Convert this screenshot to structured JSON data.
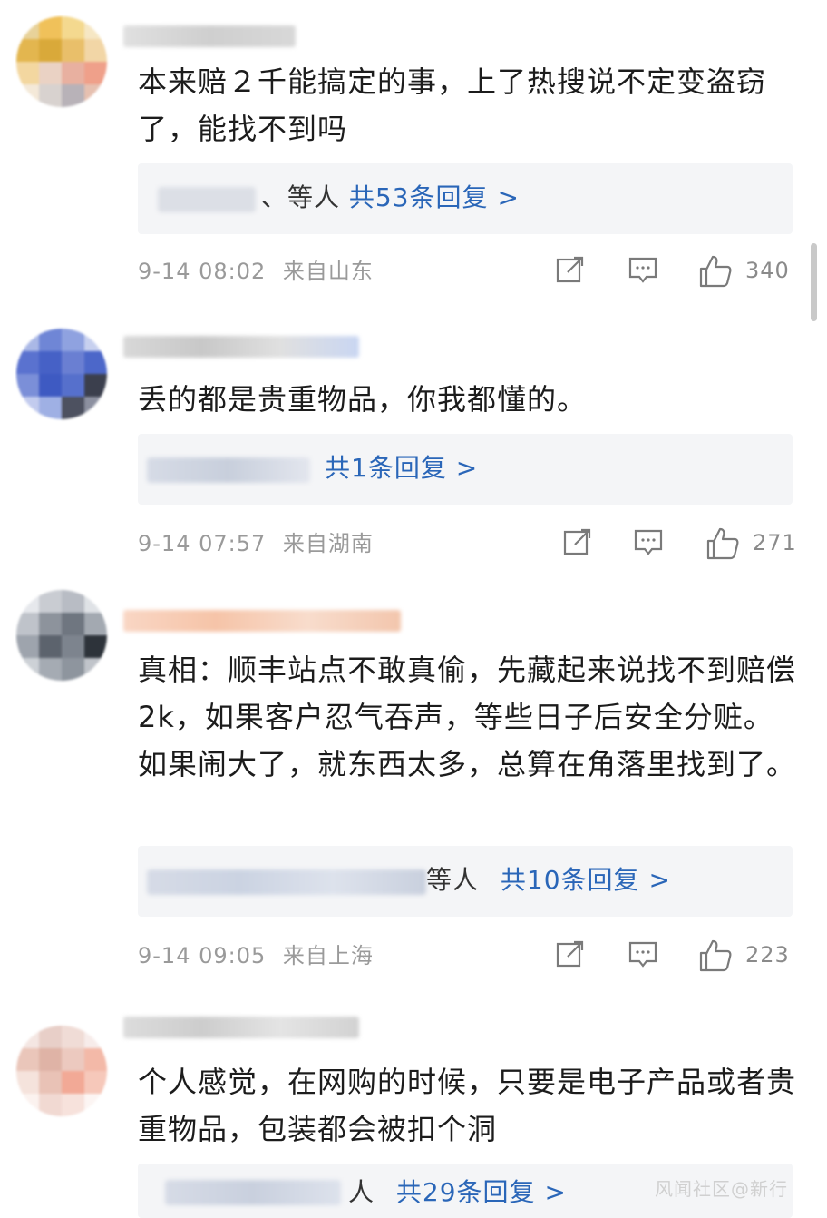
{
  "comments": [
    {
      "text": "本来赔２千能搞定的事，上了热搜说不定变盗窃了，能找不到吗",
      "reply_who": "、等人",
      "reply_more": "共53条回复 >",
      "time": "9-14 08:02",
      "location": "来自山东",
      "likes": "340"
    },
    {
      "text": "丢的都是贵重物品，你我都懂的。",
      "reply_who": "",
      "reply_more": "共1条回复 >",
      "time": "9-14 07:57",
      "location": "来自湖南",
      "likes": "271"
    },
    {
      "text": "真相：顺丰站点不敢真偷，先藏起来说找不到赔偿2k，如果客户忍气吞声，等些日子后安全分赃。如果闹大了，就东西太多，总算在角落里找到了。",
      "reply_who": "等人",
      "reply_more": "共10条回复 >",
      "time": "9-14 09:05",
      "location": "来自上海",
      "likes": "223"
    },
    {
      "text": "个人感觉，在网购的时候，只要是电子产品或者贵重物品，包装都会被扣个洞",
      "reply_who": "人",
      "reply_more": "共29条回复 >",
      "time": "",
      "location": "",
      "likes": ""
    }
  ],
  "icons": {
    "share": "share-icon",
    "comment": "comment-icon",
    "like": "thumbs-up-icon"
  },
  "colors": {
    "link": "#2a66b8",
    "meta": "#9a9a9a",
    "reply_bg": "#f4f5f7"
  },
  "watermark": "风闻社区@新行"
}
